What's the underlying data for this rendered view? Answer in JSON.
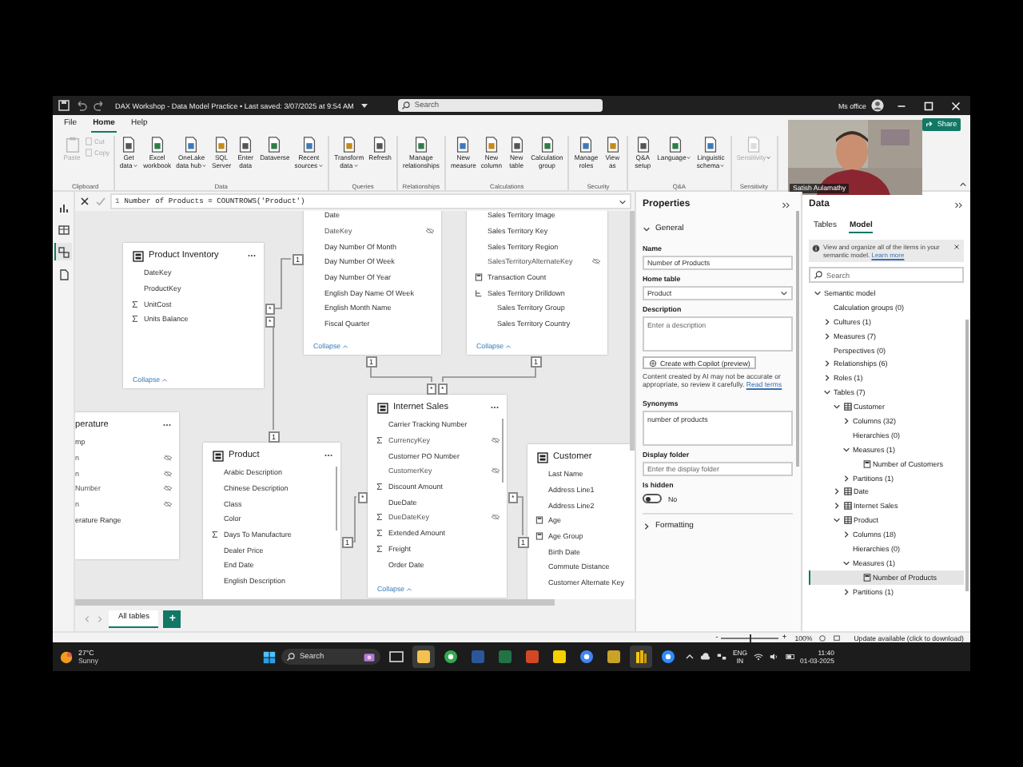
{
  "window": {
    "title": "DAX Workshop - Data Model Practice • Last saved: 3/07/2025 at 9:54 AM",
    "search": {
      "placeholder": "Search"
    },
    "account": "Ms office"
  },
  "ribbon_tabs": [
    {
      "label": "File",
      "selected": false
    },
    {
      "label": "Home",
      "selected": true
    },
    {
      "label": "Help",
      "selected": false
    }
  ],
  "share_button": "Share",
  "ribbon_groups": [
    {
      "label": "Clipboard",
      "buttons": [
        {
          "kind": "large",
          "label": [
            "Paste"
          ],
          "disabled": true,
          "dropdown": false
        },
        {
          "kind": "small",
          "label": [
            "Cut"
          ],
          "disabled": true,
          "dropdown": false
        },
        {
          "kind": "small",
          "label": [
            "Copy"
          ],
          "disabled": true,
          "dropdown": false
        }
      ]
    },
    {
      "label": "Data",
      "buttons": [
        {
          "kind": "large",
          "label": [
            "Get",
            "data"
          ],
          "disabled": false,
          "dropdown": true
        },
        {
          "kind": "large",
          "label": [
            "Excel",
            "workbook"
          ],
          "disabled": false,
          "dropdown": false
        },
        {
          "kind": "large",
          "label": [
            "OneLake",
            "data hub"
          ],
          "disabled": false,
          "dropdown": true
        },
        {
          "kind": "large",
          "label": [
            "SQL",
            "Server"
          ],
          "disabled": false,
          "dropdown": false
        },
        {
          "kind": "large",
          "label": [
            "Enter",
            "data"
          ],
          "disabled": false,
          "dropdown": false
        },
        {
          "kind": "large",
          "label": [
            "Dataverse"
          ],
          "disabled": false,
          "dropdown": false
        },
        {
          "kind": "large",
          "label": [
            "Recent",
            "sources"
          ],
          "disabled": false,
          "dropdown": true
        }
      ]
    },
    {
      "label": "Queries",
      "buttons": [
        {
          "kind": "large",
          "label": [
            "Transform",
            "data"
          ],
          "disabled": false,
          "dropdown": true
        },
        {
          "kind": "large",
          "label": [
            "Refresh"
          ],
          "disabled": false,
          "dropdown": false
        }
      ]
    },
    {
      "label": "Relationships",
      "buttons": [
        {
          "kind": "large",
          "label": [
            "Manage",
            "relationships"
          ],
          "disabled": false,
          "dropdown": false
        }
      ]
    },
    {
      "label": "Calculations",
      "buttons": [
        {
          "kind": "large",
          "label": [
            "New",
            "measure"
          ],
          "disabled": false,
          "dropdown": false
        },
        {
          "kind": "large",
          "label": [
            "New",
            "column"
          ],
          "disabled": false,
          "dropdown": false
        },
        {
          "kind": "large",
          "label": [
            "New",
            "table"
          ],
          "disabled": false,
          "dropdown": false
        },
        {
          "kind": "large",
          "label": [
            "Calculation",
            "group"
          ],
          "disabled": false,
          "dropdown": false
        }
      ]
    },
    {
      "label": "Security",
      "buttons": [
        {
          "kind": "large",
          "label": [
            "Manage",
            "roles"
          ],
          "disabled": false,
          "dropdown": false
        },
        {
          "kind": "large",
          "label": [
            "View",
            "as"
          ],
          "disabled": false,
          "dropdown": false
        }
      ]
    },
    {
      "label": "Q&A",
      "buttons": [
        {
          "kind": "large",
          "label": [
            "Q&A",
            "setup"
          ],
          "disabled": false,
          "dropdown": false
        },
        {
          "kind": "large",
          "label": [
            "Language"
          ],
          "disabled": false,
          "dropdown": true
        },
        {
          "kind": "large",
          "label": [
            "Linguistic",
            "schema"
          ],
          "disabled": false,
          "dropdown": true
        }
      ]
    },
    {
      "label": "Sensitivity",
      "buttons": [
        {
          "kind": "large",
          "label": [
            "Sensitivity"
          ],
          "disabled": true,
          "dropdown": true
        }
      ]
    }
  ],
  "webcam": {
    "name": "Satish Aulamathy"
  },
  "formula_bar": {
    "line": "1",
    "formula": "Number of Products = COUNTROWS('Product')"
  },
  "view_rail": [
    {
      "selected": false
    },
    {
      "selected": false
    },
    {
      "selected": true
    },
    {
      "selected": false
    }
  ],
  "diagram": {
    "cards": [
      {
        "title": "Product Inventory",
        "collapse": "Collapse",
        "fields": [
          {
            "name": "DateKey",
            "kind": "plain",
            "hidden": false
          },
          {
            "name": "ProductKey",
            "kind": "plain",
            "hidden": false
          },
          {
            "name": "UnitCost",
            "kind": "sum",
            "hidden": false
          },
          {
            "name": "Units Balance",
            "kind": "sum",
            "hidden": false
          }
        ]
      },
      {
        "collapse": "Collapse",
        "fields": [
          {
            "name": "Date",
            "kind": "plain",
            "hidden": false
          },
          {
            "name": "DateKey",
            "kind": "plain",
            "hidden": true
          },
          {
            "name": "Day Number Of Month",
            "kind": "plain",
            "hidden": false
          },
          {
            "name": "Day Number Of Week",
            "kind": "plain",
            "hidden": false
          },
          {
            "name": "Day Number Of Year",
            "kind": "plain",
            "hidden": false
          },
          {
            "name": "English Day Name Of Week",
            "kind": "plain",
            "hidden": false
          },
          {
            "name": "English Month Name",
            "kind": "plain",
            "hidden": false
          },
          {
            "name": "Fiscal Quarter",
            "kind": "plain",
            "hidden": false
          }
        ]
      },
      {
        "collapse": "Collapse",
        "fields": [
          {
            "name": "Sales Territory Image",
            "kind": "plain",
            "hidden": false
          },
          {
            "name": "Sales Territory Key",
            "kind": "plain",
            "hidden": false
          },
          {
            "name": "Sales Territory Region",
            "kind": "plain",
            "hidden": false
          },
          {
            "name": "SalesTerritoryAlternateKey",
            "kind": "plain",
            "hidden": true
          },
          {
            "name": "Transaction Count",
            "kind": "calc",
            "hidden": false
          },
          {
            "name": "Sales Territory Drilldown",
            "kind": "hierarchy",
            "hidden": false
          },
          {
            "name": "Sales Territory Group",
            "kind": "level",
            "hidden": false
          },
          {
            "name": "Sales Territory Country",
            "kind": "level",
            "hidden": false
          }
        ]
      },
      {
        "title": "Internet Sales",
        "collapse": "Collapse",
        "fields": [
          {
            "name": "Carrier Tracking Number",
            "kind": "plain",
            "hidden": false
          },
          {
            "name": "CurrencyKey",
            "kind": "sum",
            "hidden": true
          },
          {
            "name": "Customer PO Number",
            "kind": "plain",
            "hidden": false
          },
          {
            "name": "CustomerKey",
            "kind": "plain",
            "hidden": true
          },
          {
            "name": "Discount Amount",
            "kind": "sum",
            "hidden": false
          },
          {
            "name": "DueDate",
            "kind": "plain",
            "hidden": false
          },
          {
            "name": "DueDateKey",
            "kind": "sum",
            "hidden": true
          },
          {
            "name": "Extended Amount",
            "kind": "sum",
            "hidden": false
          },
          {
            "name": "Freight",
            "kind": "sum",
            "hidden": false
          },
          {
            "name": "Order Date",
            "kind": "plain",
            "hidden": false
          }
        ]
      },
      {
        "title": "Product",
        "fields": [
          {
            "name": "Arabic Description",
            "kind": "plain",
            "hidden": false
          },
          {
            "name": "Chinese Description",
            "kind": "plain",
            "hidden": false
          },
          {
            "name": "Class",
            "kind": "plain",
            "hidden": false
          },
          {
            "name": "Color",
            "kind": "plain",
            "hidden": false
          },
          {
            "name": "Days To Manufacture",
            "kind": "sum",
            "hidden": false
          },
          {
            "name": "Dealer Price",
            "kind": "plain",
            "hidden": false
          },
          {
            "name": "End Date",
            "kind": "plain",
            "hidden": false
          },
          {
            "name": "English Description",
            "kind": "plain",
            "hidden": false
          }
        ]
      },
      {
        "title": "Customer",
        "fields": [
          {
            "name": "Last Name",
            "kind": "plain",
            "hidden": false
          },
          {
            "name": "Address Line1",
            "kind": "plain",
            "hidden": false
          },
          {
            "name": "Address Line2",
            "kind": "plain",
            "hidden": false
          },
          {
            "name": "Age",
            "kind": "calc",
            "hidden": false
          },
          {
            "name": "Age Group",
            "kind": "calc",
            "hidden": false
          },
          {
            "name": "Birth Date",
            "kind": "plain",
            "hidden": false
          },
          {
            "name": "Commute Distance",
            "kind": "plain",
            "hidden": false
          },
          {
            "name": "Customer Alternate Key",
            "kind": "plain",
            "hidden": false
          }
        ]
      },
      {
        "title": "perature",
        "fields": [
          {
            "name": "mp",
            "kind": "plain",
            "hidden": false
          },
          {
            "name": "n",
            "kind": "plain",
            "hidden": true
          },
          {
            "name": "n",
            "kind": "plain",
            "hidden": true
          },
          {
            "name": "Number",
            "kind": "plain",
            "hidden": true
          },
          {
            "name": "n",
            "kind": "plain",
            "hidden": true
          },
          {
            "name": "erature Range",
            "kind": "plain",
            "hidden": false
          }
        ]
      }
    ],
    "relationships": [
      {
        "one": "1",
        "many": "*"
      },
      {
        "one": "1",
        "many": "*"
      },
      {
        "one": "1",
        "many": "*"
      },
      {
        "one": "1",
        "many": "*"
      },
      {
        "one": "1",
        "many": "*"
      },
      {
        "one": "1",
        "many": "*"
      }
    ],
    "layout_tabs": [
      {
        "label": "All tables",
        "selected": true
      }
    ],
    "add_button": "+"
  },
  "properties": {
    "title": "Properties",
    "general": "General",
    "name": {
      "label": "Name",
      "value": "Number of Products"
    },
    "home_table": {
      "label": "Home table",
      "value": "Product"
    },
    "description": {
      "label": "Description",
      "placeholder": "Enter a description"
    },
    "copilot_button": "Create with Copilot (preview)",
    "ai_note": "Content created by AI may not be accurate or appropriate, so review it carefully.",
    "ai_note_link": "Read terms",
    "synonyms": {
      "label": "Synonyms",
      "value": "number of products"
    },
    "display_folder": {
      "label": "Display folder",
      "placeholder": "Enter the display folder"
    },
    "is_hidden": {
      "label": "Is hidden",
      "on": false,
      "state": "No"
    },
    "formatting": "Formatting"
  },
  "data_pane": {
    "title": "Data",
    "tabs": [
      {
        "label": "Tables",
        "selected": false
      },
      {
        "label": "Model",
        "selected": true
      }
    ],
    "info": {
      "text": "View and organize all of the items in your semantic model.",
      "link": "Learn more"
    },
    "search": {
      "placeholder": "Search"
    },
    "tree": [
      {
        "label": "Semantic model",
        "expanded": true,
        "selected": false,
        "children": [
          {
            "label": "Calculation groups (0)",
            "selected": false
          },
          {
            "label": "Cultures (1)",
            "expanded": false,
            "selected": false
          },
          {
            "label": "Measures (7)",
            "expanded": false,
            "selected": false
          },
          {
            "label": "Perspectives (0)",
            "selected": false
          },
          {
            "label": "Relationships (6)",
            "expanded": false,
            "selected": false
          },
          {
            "label": "Roles (1)",
            "expanded": false,
            "selected": false
          },
          {
            "label": "Tables (7)",
            "expanded": true,
            "selected": false,
            "children": [
              {
                "label": "Customer",
                "kind": "table",
                "expanded": true,
                "selected": false,
                "children": [
                  {
                    "label": "Columns (32)",
                    "expanded": false,
                    "selected": false
                  },
                  {
                    "label": "Hierarchies (0)",
                    "selected": false
                  },
                  {
                    "label": "Measures (1)",
                    "expanded": true,
                    "selected": false,
                    "children": [
                      {
                        "label": "Number of Customers",
                        "kind": "measure",
                        "selected": false
                      }
                    ]
                  },
                  {
                    "label": "Partitions (1)",
                    "expanded": false,
                    "selected": false
                  }
                ]
              },
              {
                "label": "Date",
                "kind": "table",
                "expanded": false,
                "selected": false
              },
              {
                "label": "Internet Sales",
                "kind": "table",
                "expanded": false,
                "selected": false
              },
              {
                "label": "Product",
                "kind": "table",
                "expanded": true,
                "selected": false,
                "children": [
                  {
                    "label": "Columns (18)",
                    "expanded": false,
                    "selected": false
                  },
                  {
                    "label": "Hierarchies (0)",
                    "selected": false
                  },
                  {
                    "label": "Measures (1)",
                    "expanded": true,
                    "selected": false,
                    "children": [
                      {
                        "label": "Number of Products",
                        "kind": "measure",
                        "selected": true
                      }
                    ]
                  },
                  {
                    "label": "Partitions (1)",
                    "expanded": false,
                    "selected": false
                  }
                ]
              }
            ]
          }
        ]
      }
    ]
  },
  "status_bar": {
    "zoom_out": "-",
    "zoom_in": "+",
    "zoom": {
      "level": 0.5,
      "reading": "100%"
    },
    "update": "Update available (click to download)"
  },
  "taskbar": {
    "weather": {
      "temp": "27°C",
      "condition": "Sunny"
    },
    "search": {
      "placeholder": "Search"
    },
    "language": {
      "lang": "ENG",
      "region": "IN"
    },
    "time": "11:40",
    "date": "01-03-2025"
  }
}
